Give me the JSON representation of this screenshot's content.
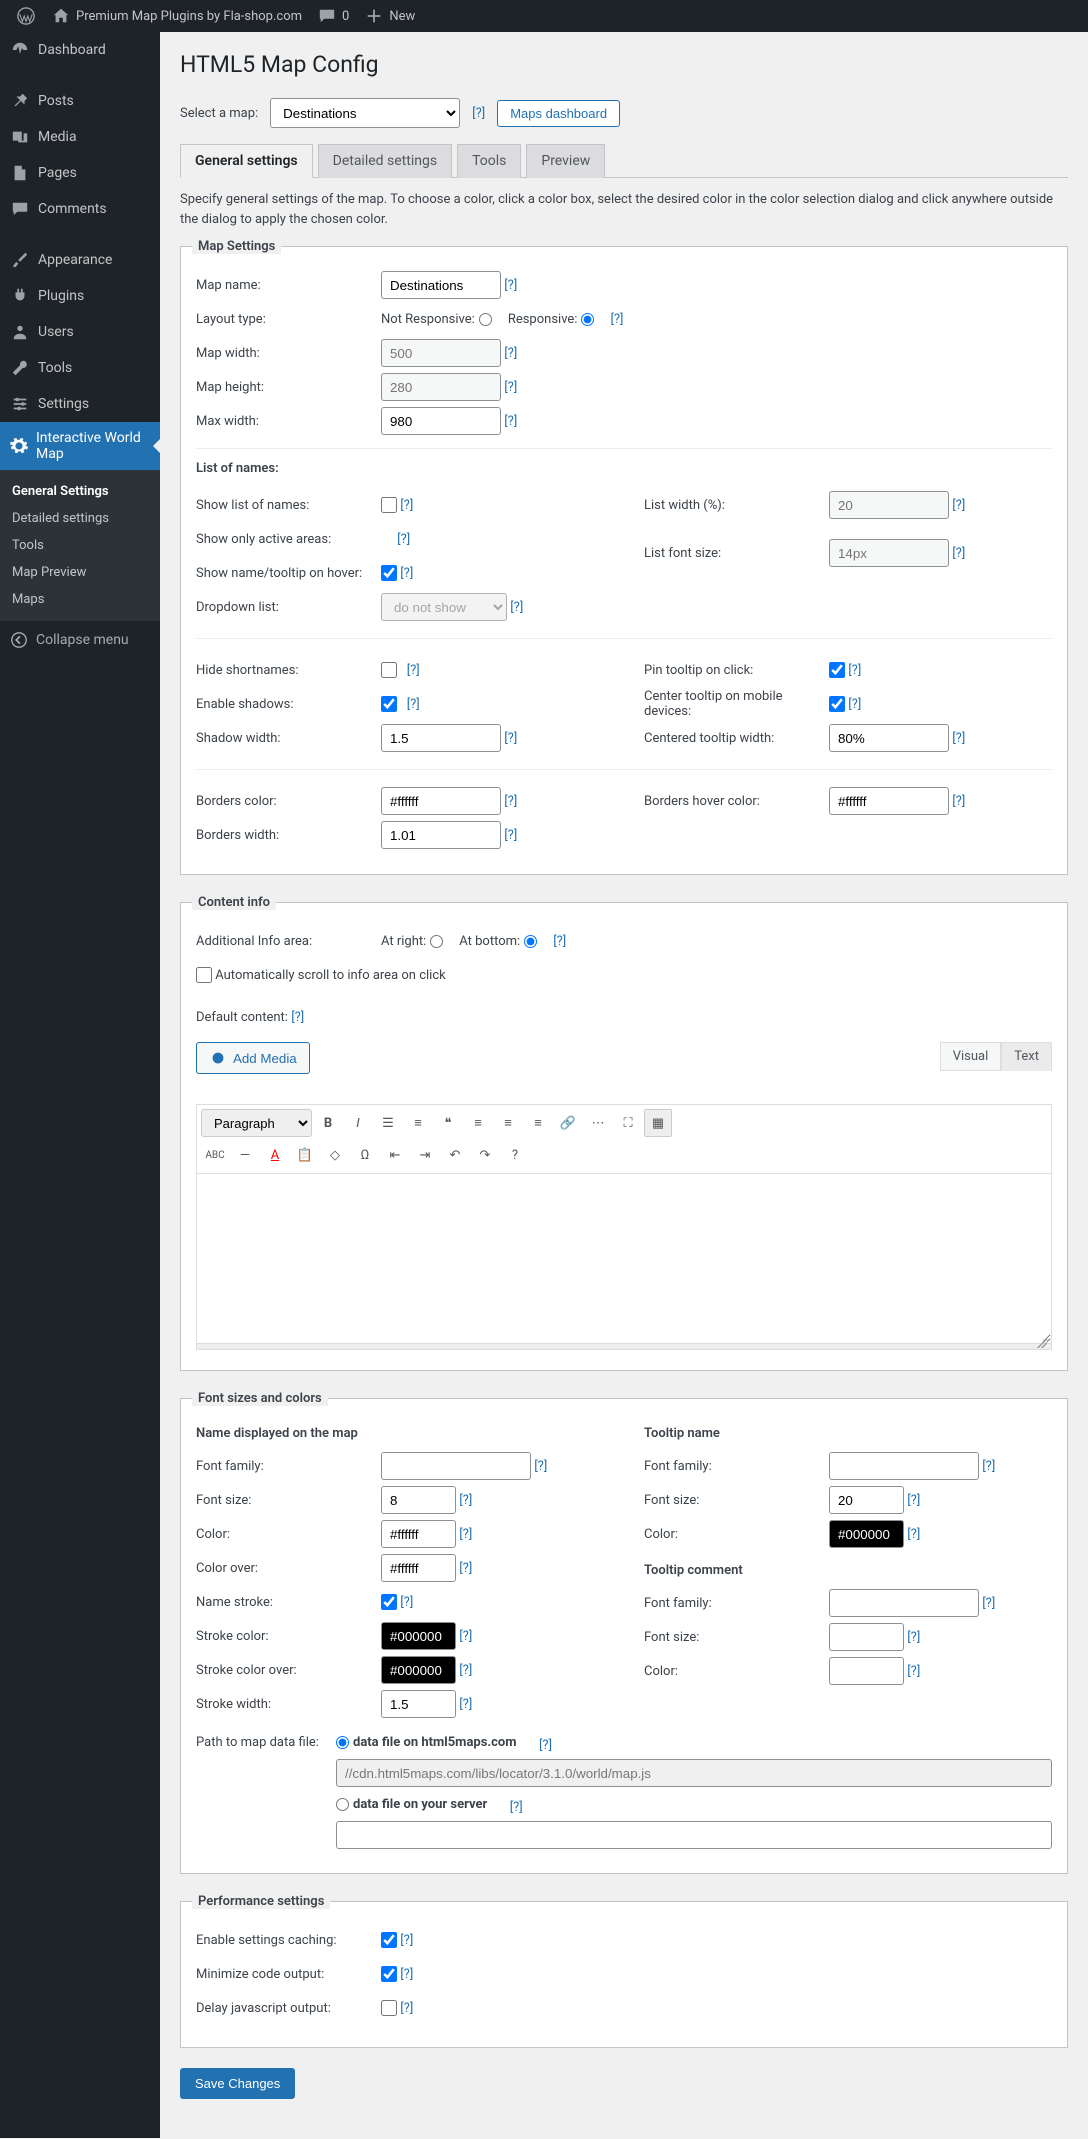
{
  "adminbar": {
    "site_title": "Premium Map Plugins by Fla-shop.com",
    "comments": "0",
    "new": "New"
  },
  "sidebar": {
    "dashboard": "Dashboard",
    "posts": "Posts",
    "media": "Media",
    "pages": "Pages",
    "comments": "Comments",
    "appearance": "Appearance",
    "plugins": "Plugins",
    "users": "Users",
    "tools": "Tools",
    "settings": "Settings",
    "iwm": "Interactive World Map",
    "sub_general": "General Settings",
    "sub_detailed": "Detailed settings",
    "sub_tools": "Tools",
    "sub_preview": "Map Preview",
    "sub_maps": "Maps",
    "collapse": "Collapse menu"
  },
  "page": {
    "title": "HTML5 Map Config",
    "select_map_label": "Select a map:",
    "select_map_value": "Destinations",
    "maps_dashboard": "Maps dashboard",
    "tabs": {
      "general": "General settings",
      "detailed": "Detailed settings",
      "tools": "Tools",
      "preview": "Preview"
    },
    "description": "Specify general settings of the map. To choose a color, click a color box, select the desired color in the color selection dialog and click anywhere outside the dialog to apply the chosen color."
  },
  "map_settings": {
    "legend": "Map Settings",
    "map_name_label": "Map name:",
    "map_name_value": "Destinations",
    "layout_label": "Layout type:",
    "layout_not_responsive": "Not Responsive:",
    "layout_responsive": "Responsive:",
    "map_width_label": "Map width:",
    "map_width_value": "500",
    "map_height_label": "Map height:",
    "map_height_value": "280",
    "max_width_label": "Max width:",
    "max_width_value": "980",
    "list_header": "List of names:",
    "show_list_label": "Show list of names:",
    "show_active_label": "Show only active areas:",
    "show_hover_label": "Show name/tooltip on hover:",
    "dropdown_label": "Dropdown list:",
    "dropdown_value": "do not show",
    "list_width_label": "List width (%):",
    "list_width_value": "20",
    "list_font_label": "List font size:",
    "list_font_value": "14px",
    "hide_shortnames_label": "Hide shortnames:",
    "enable_shadows_label": "Enable shadows:",
    "shadow_width_label": "Shadow width:",
    "shadow_width_value": "1.5",
    "pin_tooltip_label": "Pin tooltip on click:",
    "center_tooltip_label": "Center tooltip on mobile devices:",
    "centered_width_label": "Centered tooltip width:",
    "centered_width_value": "80%",
    "borders_color_label": "Borders color:",
    "borders_color_value": "#ffffff",
    "borders_hover_label": "Borders hover color:",
    "borders_hover_value": "#ffffff",
    "borders_width_label": "Borders width:",
    "borders_width_value": "1.01"
  },
  "content_info": {
    "legend": "Content info",
    "area_label": "Additional Info area:",
    "area_right": "At right:",
    "area_bottom": "At bottom:",
    "auto_scroll": "Automatically scroll to info area on click",
    "default_content_label": "Default content:",
    "add_media": "Add Media",
    "visual": "Visual",
    "text": "Text",
    "paragraph": "Paragraph"
  },
  "fonts": {
    "legend": "Font sizes and colors",
    "name_map_header": "Name displayed on the map",
    "tooltip_name_header": "Tooltip name",
    "tooltip_comment_header": "Tooltip comment",
    "font_family_label": "Font family:",
    "font_size_label": "Font size:",
    "color_label": "Color:",
    "color_over_label": "Color over:",
    "name_stroke_label": "Name stroke:",
    "stroke_color_label": "Stroke color:",
    "stroke_color_over_label": "Stroke color over:",
    "stroke_width_label": "Stroke width:",
    "name_font_size": "8",
    "name_color": "#ffffff",
    "name_color_over": "#ffffff",
    "stroke_color": "#000000",
    "stroke_color_over": "#000000",
    "stroke_width": "1.5",
    "tooltip_font_size": "20",
    "tooltip_color": "#000000",
    "path_label": "Path to map data file:",
    "path_remote": "data file on html5maps.com",
    "path_local": "data file on your server",
    "path_url": "//cdn.html5maps.com/libs/locator/3.1.0/world/map.js"
  },
  "performance": {
    "legend": "Performance settings",
    "caching_label": "Enable settings caching:",
    "minimize_label": "Minimize code output:",
    "delay_label": "Delay javascript output:"
  },
  "save": "Save Changes"
}
